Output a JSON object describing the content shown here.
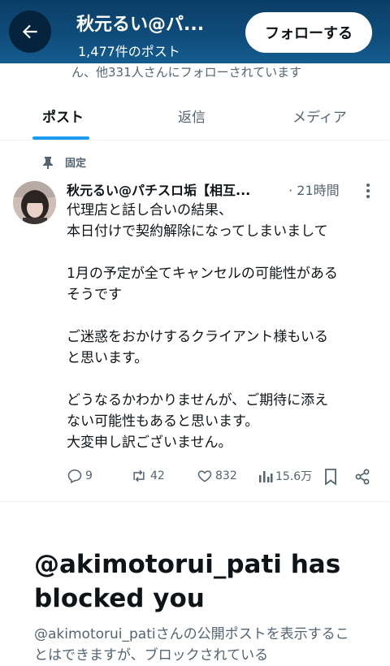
{
  "header": {
    "title": "秋元るい@パ...",
    "post_count": "1,477件のポスト",
    "follow_label": "フォローする"
  },
  "followed_by": "ん、他331人さんにフォローされています",
  "tabs": [
    {
      "label": "ポスト"
    },
    {
      "label": "返信"
    },
    {
      "label": "メディア"
    }
  ],
  "pinned_label": "固定",
  "tweet": {
    "name": "秋元るい@パチスロ垢【相互...",
    "time": "· 21時間",
    "paragraphs": [
      [
        "代理店と話し合いの結果、",
        "本日付けで契約解除になってしまいまして"
      ],
      [
        "1月の予定が全てキャンセルの可能性がある",
        "そうです"
      ],
      [
        "ご迷惑をおかけするクライアント様もいる",
        "と思います。"
      ],
      [
        "どうなるかわかりませんが、ご期待に添え",
        "ない可能性もあると思います。",
        "大変申し訳ございません。"
      ]
    ],
    "stats": {
      "replies": "9",
      "reposts": "42",
      "likes": "832",
      "views": "15.6万"
    }
  },
  "blocked": {
    "title": "@akimotorui_pati has blocked you",
    "desc": "@akimotorui_patiさんの公開ポストを表示することはできますが、ブロックされている"
  },
  "colors": {
    "header_bg": "#0f4c7b",
    "accent": "#1d9bf0",
    "muted": "#536471"
  }
}
